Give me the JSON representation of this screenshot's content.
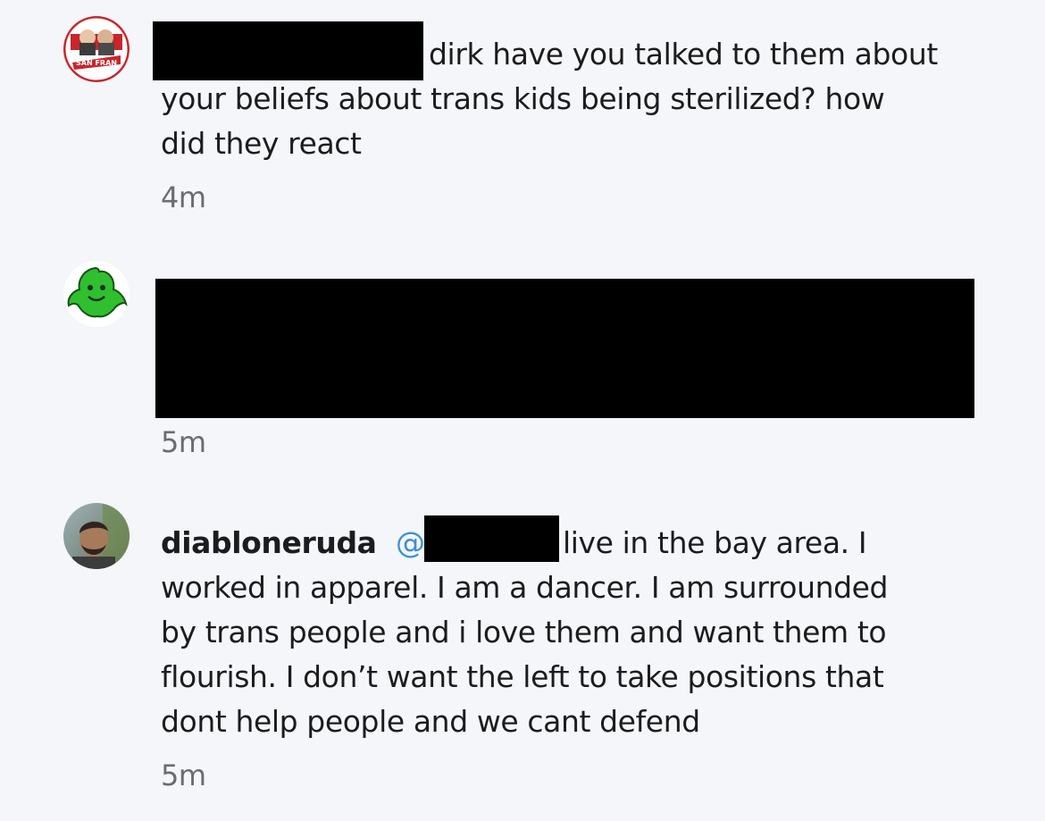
{
  "comments": [
    {
      "avatar_icon": "podcast-logo-avatar",
      "lines": [
        "dirk have you talked to them about",
        "your beliefs about trans kids being sterilized?  how",
        "did they react"
      ],
      "time": "4m"
    },
    {
      "avatar_icon": "green-ghost-avatar",
      "lines": [],
      "time": "5m"
    },
    {
      "avatar_icon": "user-photo-avatar",
      "username": "diabloneruda",
      "mention_symbol": "@",
      "lines": [
        "live in the bay area. I",
        "worked in apparel. I am a dancer. I am surrounded",
        "by trans people and i love them and want them to",
        "flourish. I don’t want the left to take positions that",
        "dont  help people and we cant defend"
      ],
      "time": "5m"
    }
  ],
  "colors": {
    "background": "#f5f6f9",
    "text": "#1c1c1e",
    "timestamp": "#6b6b70",
    "mention": "#3a8fd6",
    "redaction": "#000000"
  }
}
